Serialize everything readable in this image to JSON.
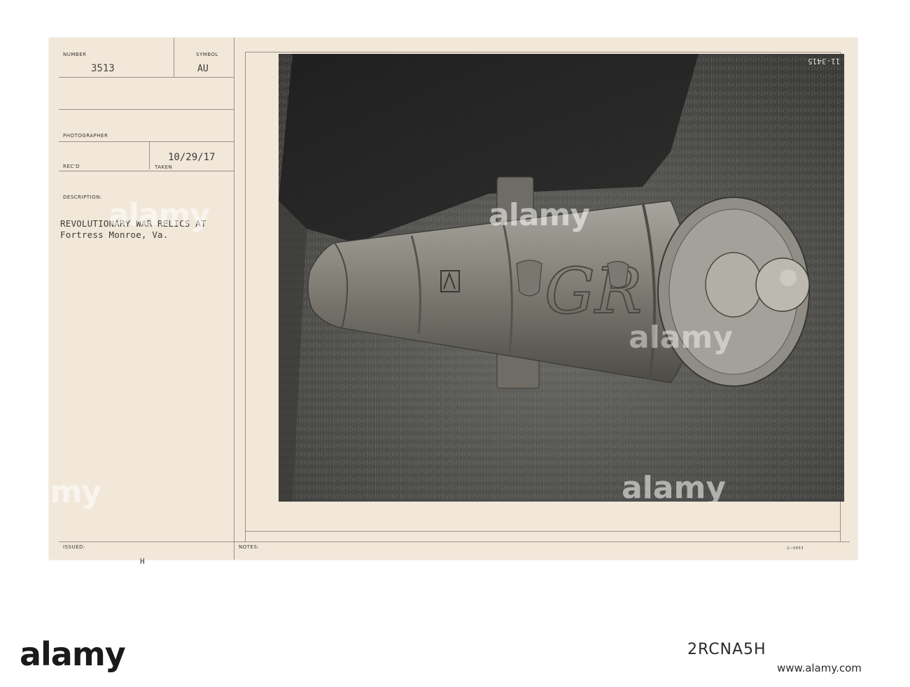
{
  "card": {
    "number_label": "NUMBER",
    "number_value": "3513",
    "symbol_label": "SYMBOL",
    "symbol_value": "AU",
    "photographer_label": "PHOTOGRAPHER",
    "recd_label": "REC'D",
    "taken_label": "TAKEN",
    "taken_value": "10/29/17",
    "description_label": "DESCRIPTION:",
    "description_line1": "REVOLUTIONARY WAR RELICS AT",
    "description_line2": "Fortress Monroe, Va.",
    "issued_label": "ISSUED:",
    "issued_value": "H",
    "notes_label": "NOTES:",
    "form_code": "2—5653",
    "photo_number": "11-3415"
  },
  "watermark": {
    "text": "alamy"
  },
  "footer": {
    "brand": "alamy",
    "image_id": "2RCNA5H",
    "link": "www.alamy.com"
  }
}
